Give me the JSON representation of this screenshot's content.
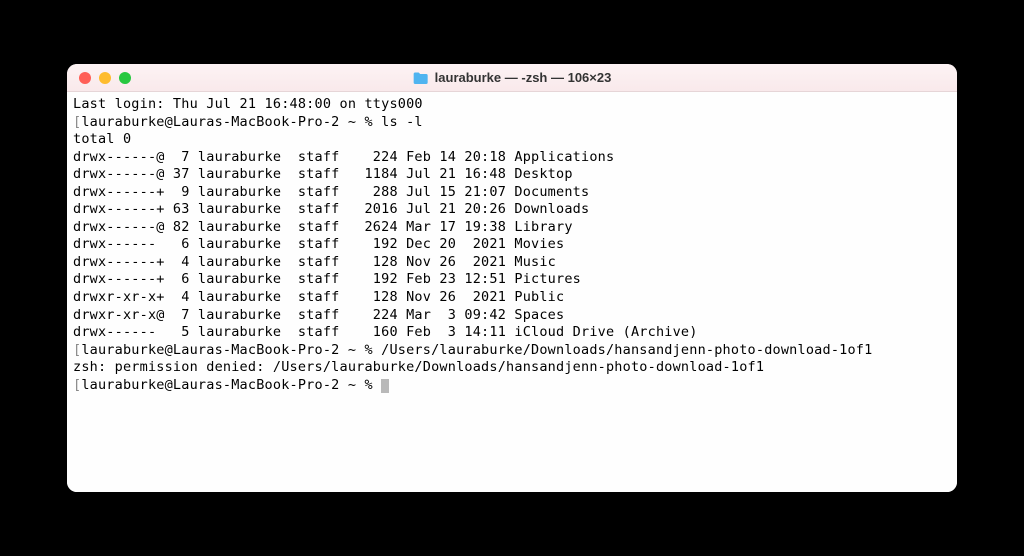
{
  "window": {
    "title": "lauraburke — -zsh — 106×23"
  },
  "lastLogin": "Last login: Thu Jul 21 16:48:00 on ttys000",
  "prompt1": {
    "userhost": "lauraburke@Lauras-MacBook-Pro-2",
    "path": "~",
    "symbol": "%",
    "command": "ls -l"
  },
  "lsTotal": "total 0",
  "entries": [
    {
      "perm": "drwx------@",
      "links": " 7",
      "owner": "lauraburke",
      "group": "staff",
      "size": "  224",
      "date": "Feb 14 20:18",
      "name": "Applications"
    },
    {
      "perm": "drwx------@",
      "links": "37",
      "owner": "lauraburke",
      "group": "staff",
      "size": " 1184",
      "date": "Jul 21 16:48",
      "name": "Desktop"
    },
    {
      "perm": "drwx------+",
      "links": " 9",
      "owner": "lauraburke",
      "group": "staff",
      "size": "  288",
      "date": "Jul 15 21:07",
      "name": "Documents"
    },
    {
      "perm": "drwx------+",
      "links": "63",
      "owner": "lauraburke",
      "group": "staff",
      "size": " 2016",
      "date": "Jul 21 20:26",
      "name": "Downloads"
    },
    {
      "perm": "drwx------@",
      "links": "82",
      "owner": "lauraburke",
      "group": "staff",
      "size": " 2624",
      "date": "Mar 17 19:38",
      "name": "Library"
    },
    {
      "perm": "drwx------ ",
      "links": " 6",
      "owner": "lauraburke",
      "group": "staff",
      "size": "  192",
      "date": "Dec 20  2021",
      "name": "Movies"
    },
    {
      "perm": "drwx------+",
      "links": " 4",
      "owner": "lauraburke",
      "group": "staff",
      "size": "  128",
      "date": "Nov 26  2021",
      "name": "Music"
    },
    {
      "perm": "drwx------+",
      "links": " 6",
      "owner": "lauraburke",
      "group": "staff",
      "size": "  192",
      "date": "Feb 23 12:51",
      "name": "Pictures"
    },
    {
      "perm": "drwxr-xr-x+",
      "links": " 4",
      "owner": "lauraburke",
      "group": "staff",
      "size": "  128",
      "date": "Nov 26  2021",
      "name": "Public"
    },
    {
      "perm": "drwxr-xr-x@",
      "links": " 7",
      "owner": "lauraburke",
      "group": "staff",
      "size": "  224",
      "date": "Mar  3 09:42",
      "name": "Spaces"
    },
    {
      "perm": "drwx------ ",
      "links": " 5",
      "owner": "lauraburke",
      "group": "staff",
      "size": "  160",
      "date": "Feb  3 14:11",
      "name": "iCloud Drive (Archive)"
    }
  ],
  "prompt2": {
    "userhost": "lauraburke@Lauras-MacBook-Pro-2",
    "path": "~",
    "symbol": "%",
    "command": "/Users/lauraburke/Downloads/hansandjenn-photo-download-1of1"
  },
  "error": "zsh: permission denied: /Users/lauraburke/Downloads/hansandjenn-photo-download-1of1",
  "prompt3": {
    "userhost": "lauraburke@Lauras-MacBook-Pro-2",
    "path": "~",
    "symbol": "%"
  }
}
